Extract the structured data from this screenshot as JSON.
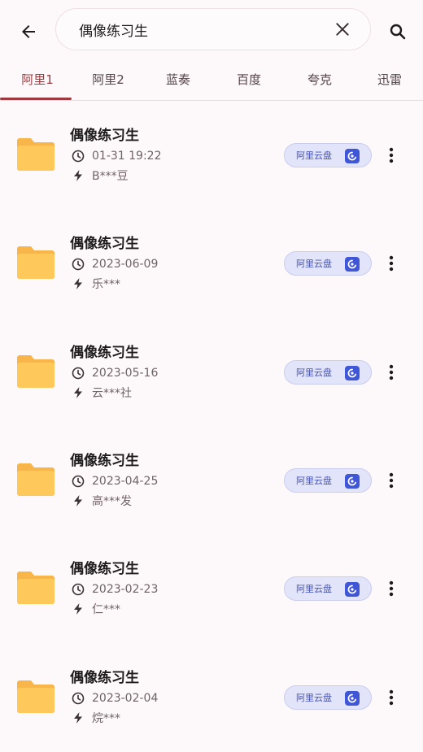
{
  "search": {
    "query": "偶像练习生"
  },
  "tabs": [
    {
      "label": "阿里1",
      "active": true
    },
    {
      "label": "阿里2"
    },
    {
      "label": "蓝奏"
    },
    {
      "label": "百度"
    },
    {
      "label": "夸克"
    },
    {
      "label": "迅雷"
    }
  ],
  "results": [
    {
      "title": "偶像练习生",
      "date": "01-31 19:22",
      "user": "B***豆",
      "badge": "阿里云盘"
    },
    {
      "title": "偶像练习生",
      "date": "2023-06-09",
      "user": "乐***",
      "badge": "阿里云盘"
    },
    {
      "title": "偶像练习生",
      "date": "2023-05-16",
      "user": "云***社",
      "badge": "阿里云盘"
    },
    {
      "title": "偶像练习生",
      "date": "2023-04-25",
      "user": "高***发",
      "badge": "阿里云盘"
    },
    {
      "title": "偶像练习生",
      "date": "2023-02-23",
      "user": "仁***",
      "badge": "阿里云盘"
    },
    {
      "title": "偶像练习生",
      "date": "2023-02-04",
      "user": "烷***",
      "badge": "阿里云盘"
    }
  ],
  "colors": {
    "accent": "#9c3a3f",
    "folder": "#ffc85a",
    "badge_bg": "#e2e4fa",
    "badge_text": "#4654b8"
  }
}
